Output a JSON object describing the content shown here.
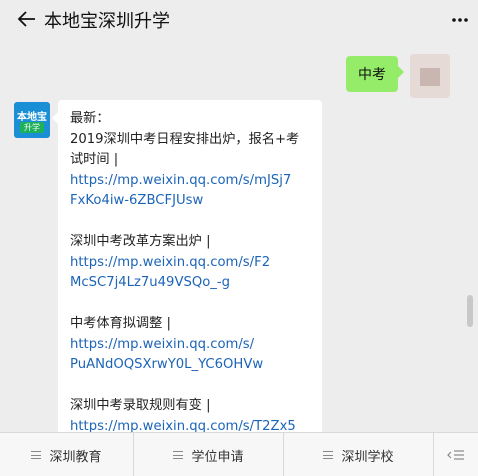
{
  "header": {
    "title": "本地宝深圳升学"
  },
  "chat": {
    "user_message": "中考",
    "bot_avatar": {
      "line1": "本地宝",
      "line2": "升学"
    },
    "bot_lines": [
      {
        "text": "最新：",
        "type": "text"
      },
      {
        "text": "2019深圳中考日程安排出炉，报名+考",
        "type": "text"
      },
      {
        "text": "试时间 |",
        "type": "text"
      },
      {
        "text": "https://mp.weixin.qq.com/s/mJSj7",
        "type": "link"
      },
      {
        "text": "FxKo4iw-6ZBCFJUsw",
        "type": "link"
      },
      {
        "text": "",
        "type": "gap"
      },
      {
        "text": "深圳中考改革方案出炉 |",
        "type": "text"
      },
      {
        "text": "https://mp.weixin.qq.com/s/F2",
        "type": "link"
      },
      {
        "text": "McSC7j4Lz7u49VSQo_-g",
        "type": "link"
      },
      {
        "text": "",
        "type": "gap"
      },
      {
        "text": "中考体育拟调整 |",
        "type": "text"
      },
      {
        "text": "https://mp.weixin.qq.com/s/",
        "type": "link"
      },
      {
        "text": "PuANdOQSXrwY0L_YC6OHVw",
        "type": "link"
      },
      {
        "text": "",
        "type": "gap"
      },
      {
        "text": "深圳中考录取规则有变 |",
        "type": "text"
      },
      {
        "text": "https://mp.weixin.qq.com/s/T2Zx5",
        "type": "link"
      }
    ]
  },
  "menu": {
    "items": [
      "深圳教育",
      "学位申请",
      "深圳学校"
    ],
    "switch_icon": "keyboard-switch-icon"
  },
  "colors": {
    "link": "#1c64b8",
    "user_bubble": "#95ec69",
    "brand_avatar": "#1a8fd6"
  }
}
